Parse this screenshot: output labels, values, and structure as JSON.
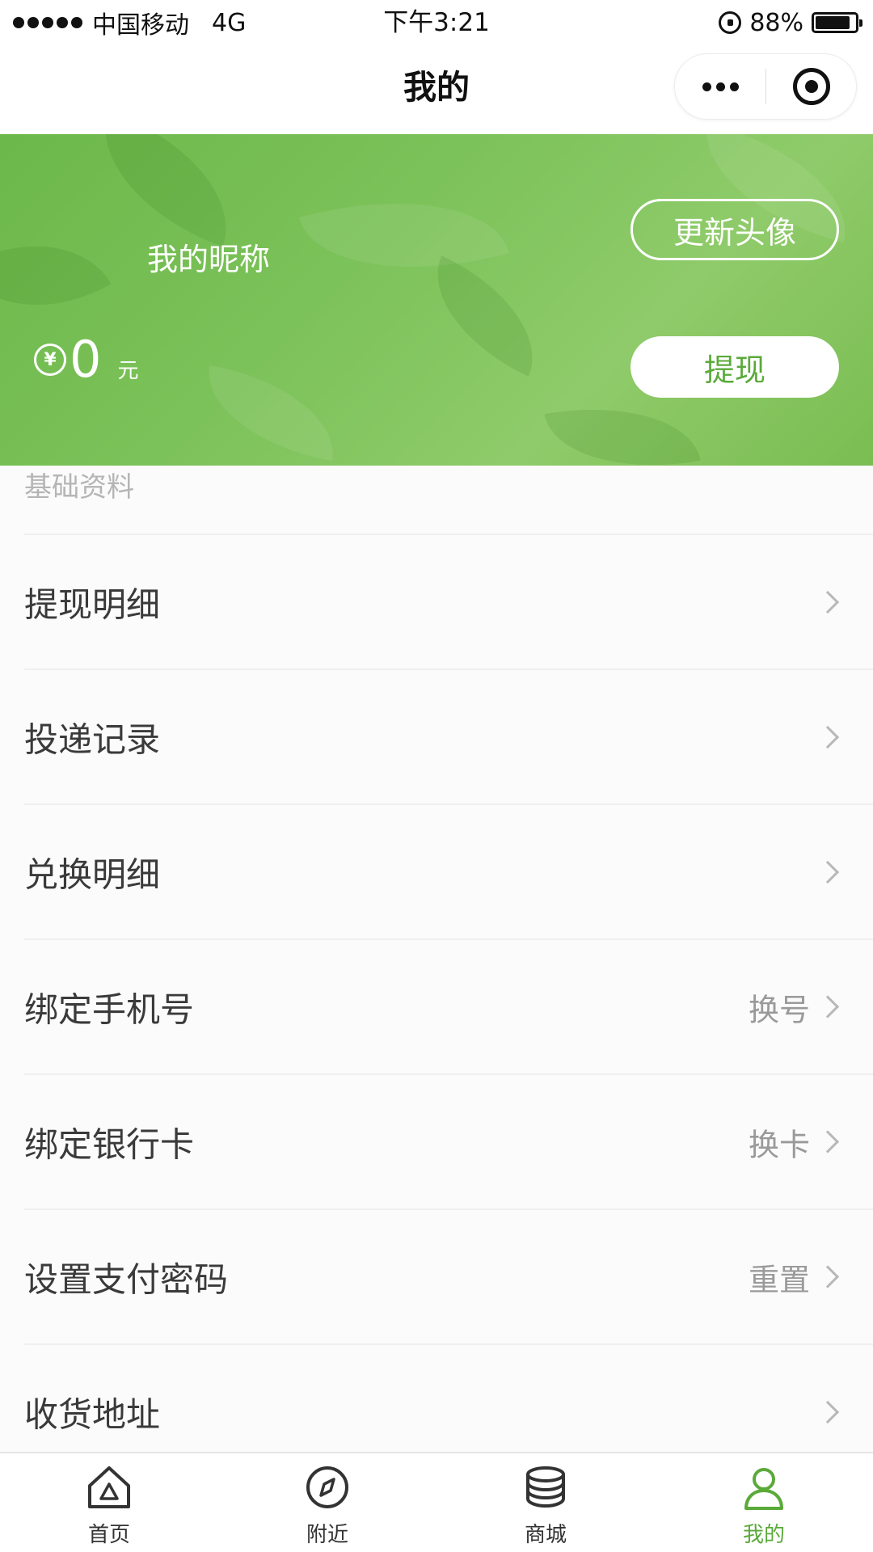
{
  "status_bar": {
    "carrier": "中国移动",
    "network": "4G",
    "time": "下午3:21",
    "battery": "88%",
    "battery_level": 0.88
  },
  "nav": {
    "title": "我的"
  },
  "profile": {
    "nickname": "我的昵称",
    "currency_symbol": "¥",
    "balance": "0",
    "unit": "元",
    "update_avatar_label": "更新头像",
    "withdraw_label": "提现"
  },
  "section": {
    "title": "基础资料"
  },
  "menu": [
    {
      "label": "提现明细",
      "value": ""
    },
    {
      "label": "投递记录",
      "value": ""
    },
    {
      "label": "兑换明细",
      "value": ""
    },
    {
      "label": "绑定手机号",
      "value": "换号"
    },
    {
      "label": "绑定银行卡",
      "value": "换卡"
    },
    {
      "label": "设置支付密码",
      "value": "重置"
    },
    {
      "label": "收货地址",
      "value": ""
    }
  ],
  "tabs": [
    {
      "label": "首页",
      "icon": "home-icon"
    },
    {
      "label": "附近",
      "icon": "compass-icon"
    },
    {
      "label": "商城",
      "icon": "coins-icon"
    },
    {
      "label": "我的",
      "icon": "user-icon",
      "active": true
    }
  ],
  "colors": {
    "accent": "#5aaa3a",
    "banner": "#7cc25a"
  }
}
